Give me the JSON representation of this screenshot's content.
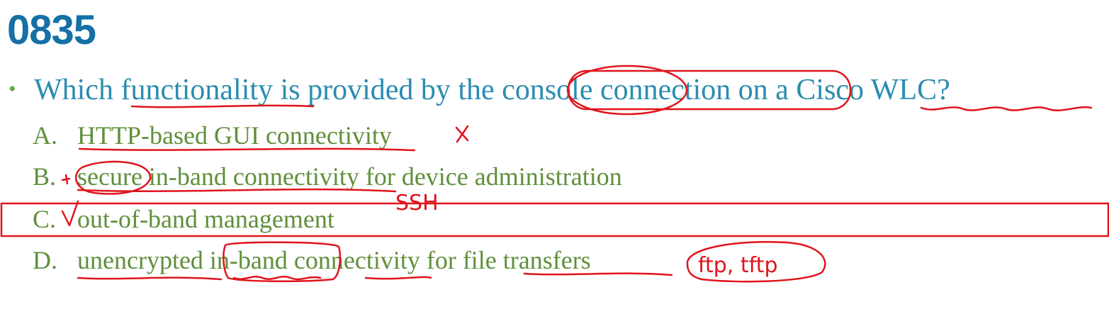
{
  "slide": {
    "title": "0835",
    "bullet": "•",
    "question": "Which functionality is provided by the console connection on a Cisco WLC?"
  },
  "options": [
    {
      "letter": "A.",
      "text": "HTTP-based GUI connectivity"
    },
    {
      "letter": "B.",
      "text": "secure in-band connectivity for device administration"
    },
    {
      "letter": "C.",
      "text": "out-of-band management"
    },
    {
      "letter": "D.",
      "text": "unencrypted in-band connectivity for file transfers"
    }
  ],
  "annotations": {
    "wrong_mark": "×",
    "checkmark": "√",
    "ssh_note": "SSH",
    "protocol_note": "ftp, tftp"
  },
  "colors": {
    "title": "#1570a6",
    "question": "#2a8cb0",
    "option": "#5f8f3a",
    "ink": "#e0141c"
  }
}
